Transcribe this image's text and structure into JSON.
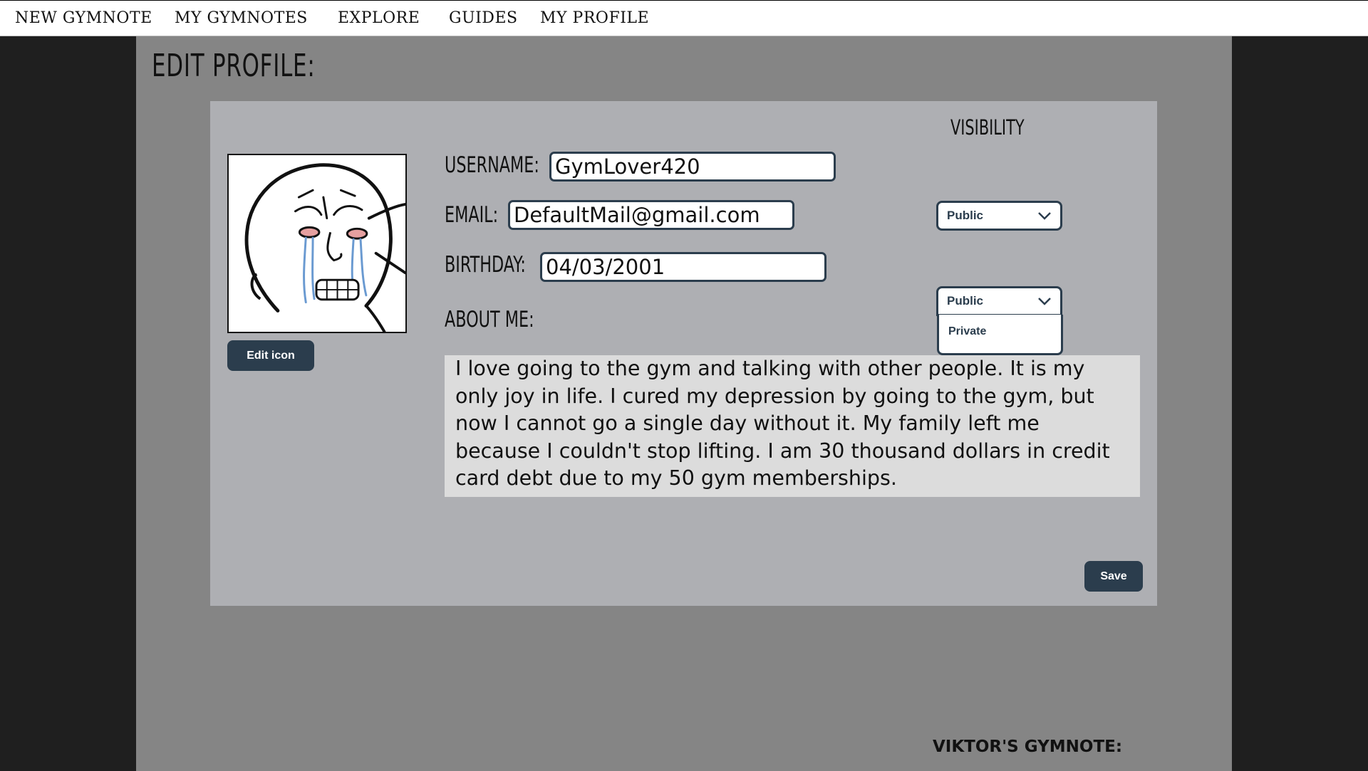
{
  "nav": {
    "items": [
      {
        "label": "NEW GYMNOTE"
      },
      {
        "label": "MY GYMNOTES"
      },
      {
        "label": "EXPLORE"
      },
      {
        "label": "GUIDES"
      },
      {
        "label": "MY PROFILE"
      }
    ]
  },
  "page": {
    "title": "EDIT PROFILE:"
  },
  "profile": {
    "avatar_icon": "crying-wojak-avatar",
    "edit_icon_label": "Edit icon",
    "visibility_title": "VISIBILITY",
    "username": {
      "label": "USERNAME:",
      "value": "GymLover420"
    },
    "email": {
      "label": "EMAIL:",
      "value": "DefaultMail@gmail.com",
      "visibility": "Public"
    },
    "birthday": {
      "label": "BIRTHDAY:",
      "value": "04/03/2001",
      "visibility": "Public",
      "dropdown_open": true,
      "options": [
        "Private"
      ]
    },
    "about": {
      "label": "ABOUT ME:",
      "text": "I love going to the gym and talking with other people. It is my only joy in life. I cured my depression by going to the gym, but now I cannot go a single day without it. My family left me because I couldn't stop lifting. I am 30 thousand dollars in credit card debt due to my 50 gym memberships."
    },
    "save_label": "Save"
  },
  "footer": {
    "brand": "VIKTOR'S GYMNOTE:"
  },
  "colors": {
    "sidebar": "#1f1f1f",
    "main": "#858585",
    "card": "#aeafb3",
    "accent_dark": "#2b3d4d",
    "about_bg": "#dcdcdc"
  }
}
